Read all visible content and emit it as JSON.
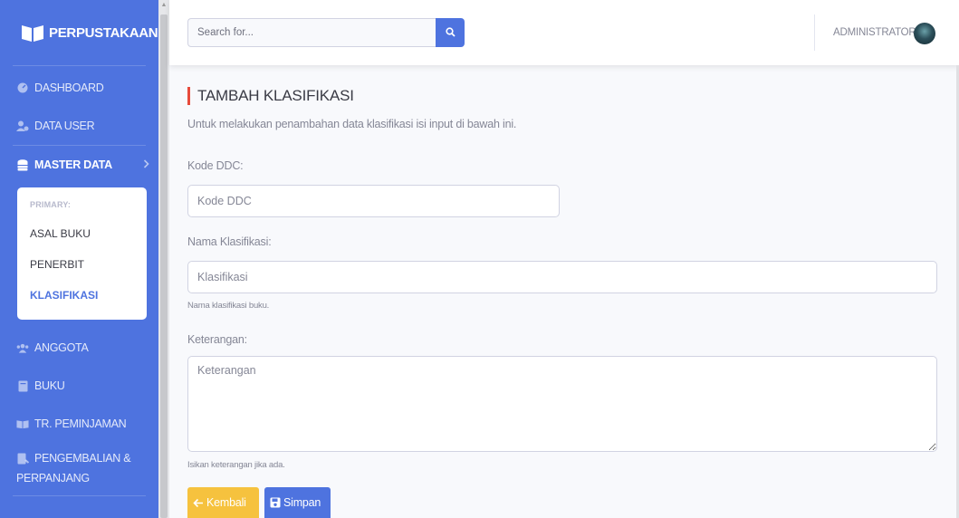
{
  "sidebar": {
    "brand": "PERPUSTAKAAN",
    "items": [
      {
        "label": "DASHBOARD",
        "icon": "dashboard-icon"
      },
      {
        "label": "DATA USER",
        "icon": "users-cog-icon"
      },
      {
        "label": "MASTER DATA",
        "icon": "database-icon"
      },
      {
        "label": "ANGGOTA",
        "icon": "users-icon"
      },
      {
        "label": "BUKU",
        "icon": "book-icon"
      },
      {
        "label": "TR. PEMINJAMAN",
        "icon": "book-open-icon"
      },
      {
        "label": "PENGEMBALIAN &",
        "label2": "PERPANJANG",
        "icon": "book-return-icon"
      }
    ],
    "collapse": {
      "header": "PRIMARY:",
      "items": [
        "ASAL BUKU",
        "PENERBIT",
        "KLASIFIKASI"
      ]
    }
  },
  "topbar": {
    "search_placeholder": "Search for...",
    "user_name": "ADMINISTRATOR"
  },
  "main": {
    "title": "TAMBAH KLASIFIKASI",
    "subtitle": "Untuk melakukan penambahan data klasifikasi isi input di bawah ini.",
    "fields": {
      "kode": {
        "label": "Kode DDC:",
        "placeholder": "Kode DDC"
      },
      "nama": {
        "label": "Nama Klasifikasi:",
        "placeholder": "Klasifikasi",
        "help": "Nama klasifikasi buku."
      },
      "keterangan": {
        "label": "Keterangan:",
        "placeholder": "Keterangan",
        "help": "Isikan keterangan jika ada."
      }
    },
    "buttons": {
      "back": "Kembali",
      "save": "Simpan"
    }
  },
  "colors": {
    "primary": "#4e73df",
    "warning": "#f6c23e",
    "accent_red": "#e74a3b"
  }
}
